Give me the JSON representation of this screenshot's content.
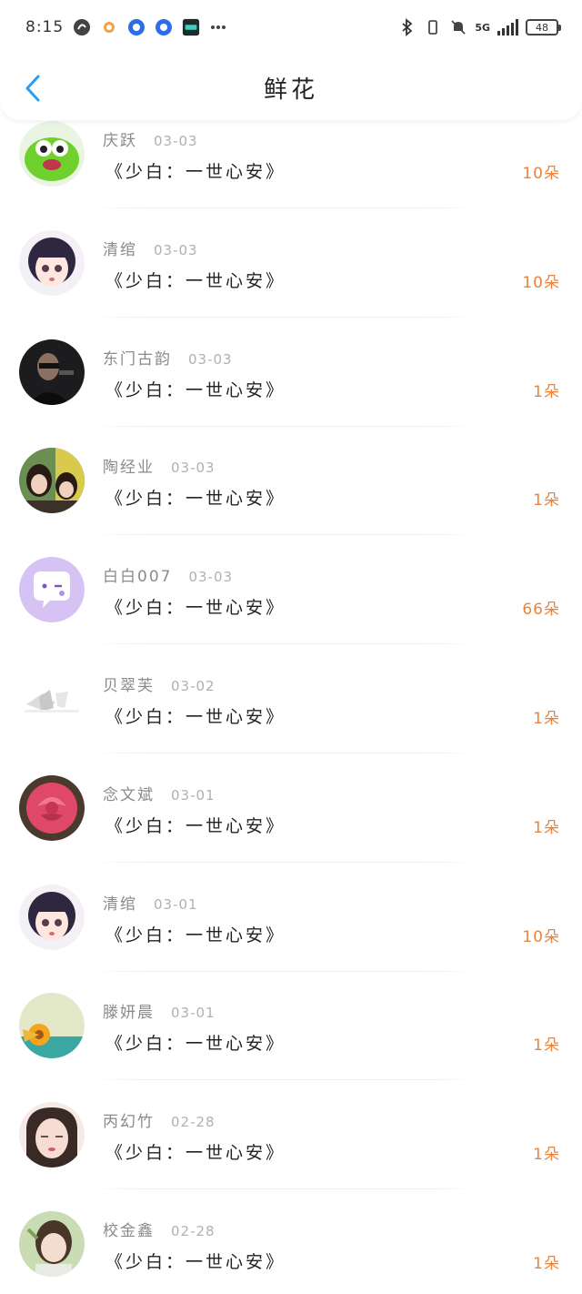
{
  "status_bar": {
    "time": "8:15",
    "network": "5G",
    "battery": "48"
  },
  "header": {
    "title": "鲜花"
  },
  "colors": {
    "amount": "#e8843d",
    "back": "#2a9df4"
  },
  "gifts": [
    {
      "name": "庆跃",
      "date": "03-03",
      "message": "《少白：一世心安》",
      "amount": "10朵"
    },
    {
      "name": "清绾",
      "date": "03-03",
      "message": "《少白：一世心安》",
      "amount": "10朵"
    },
    {
      "name": "东门古韵",
      "date": "03-03",
      "message": "《少白：一世心安》",
      "amount": "1朵"
    },
    {
      "name": "陶经业",
      "date": "03-03",
      "message": "《少白：一世心安》",
      "amount": "1朵"
    },
    {
      "name": "白白007",
      "date": "03-03",
      "message": "《少白：一世心安》",
      "amount": "66朵"
    },
    {
      "name": "贝翠芙",
      "date": "03-02",
      "message": "《少白：一世心安》",
      "amount": "1朵"
    },
    {
      "name": "念文斌",
      "date": "03-01",
      "message": "《少白：一世心安》",
      "amount": "1朵"
    },
    {
      "name": "清绾",
      "date": "03-01",
      "message": "《少白：一世心安》",
      "amount": "10朵"
    },
    {
      "name": "滕妍晨",
      "date": "03-01",
      "message": "《少白：一世心安》",
      "amount": "1朵"
    },
    {
      "name": "丙幻竹",
      "date": "02-28",
      "message": "《少白：一世心安》",
      "amount": "1朵"
    },
    {
      "name": "校金鑫",
      "date": "02-28",
      "message": "《少白：一世心安》",
      "amount": "1朵"
    }
  ]
}
